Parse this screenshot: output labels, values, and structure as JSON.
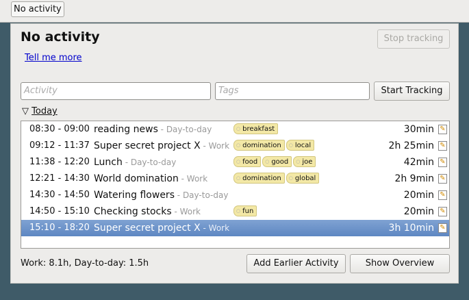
{
  "applet": {
    "label": "No activity"
  },
  "header": {
    "title": "No activity",
    "stop_label": "Stop tracking",
    "more_link": "Tell me more"
  },
  "entry": {
    "activity_placeholder": "Activity",
    "tags_placeholder": "Tags",
    "start_label": "Start Tracking"
  },
  "day": {
    "label": "Today",
    "expander_icon": "triangle-down"
  },
  "facts": [
    {
      "time": "08:30 - 09:00",
      "name": "reading news",
      "category": " - Day-to-day",
      "tags": [
        "breakfast"
      ],
      "duration": "30min"
    },
    {
      "time": "09:12 - 11:37",
      "name": "Super secret project X",
      "category": " - Work",
      "tags": [
        "domination",
        "local"
      ],
      "duration": "2h 25min"
    },
    {
      "time": "11:38 - 12:20",
      "name": "Lunch",
      "category": " - Day-to-day",
      "tags": [
        "food",
        "good",
        "joe"
      ],
      "duration": "42min"
    },
    {
      "time": "12:21 - 14:30",
      "name": "World domination",
      "category": " - Work",
      "tags": [
        "domination",
        "global"
      ],
      "duration": "2h 9min"
    },
    {
      "time": "14:30 - 14:50",
      "name": "Watering flowers",
      "category": " - Day-to-day",
      "tags": [],
      "duration": "20min"
    },
    {
      "time": "14:50 - 15:10",
      "name": "Checking stocks",
      "category": " - Work",
      "tags": [
        "fun"
      ],
      "duration": "20min"
    },
    {
      "time": "15:10 - 18:20",
      "name": "Super secret project X",
      "category": " - Work",
      "tags": [],
      "duration": "3h 10min",
      "selected": true
    }
  ],
  "footer": {
    "totals": "Work: 8.1h, Day-to-day: 1.5h",
    "add_label": "Add Earlier Activity",
    "overview_label": "Show Overview"
  }
}
